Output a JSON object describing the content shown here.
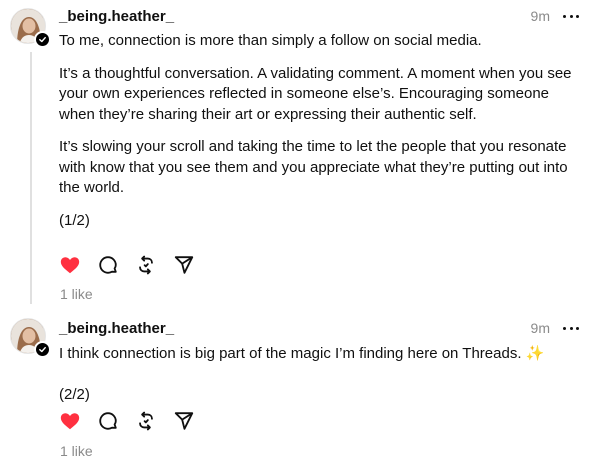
{
  "posts": [
    {
      "username": "_being.heather_",
      "time": "9m",
      "paragraphs": [
        "To me, connection is more than simply a follow on social media.",
        "It’s a thoughtful conversation. A validating comment. A moment when you see your own experiences reflected in someone else’s. Encouraging someone when they’re sharing their art or expressing their authentic self.",
        "It’s slowing your scroll and taking the time to let the people that you resonate with know that you see them and you appreciate what they’re putting out into the world.",
        "(1/2)"
      ],
      "likes": "1 like",
      "liked": true
    },
    {
      "username": "_being.heather_",
      "time": "9m",
      "paragraphs": [
        "I think connection is big part of the magic I’m finding here on Threads.",
        "(2/2)"
      ],
      "emoji": "✨",
      "likes": "1 like",
      "liked": true
    }
  ],
  "colors": {
    "like": "#ff3040",
    "muted": "#8a8a8a",
    "text": "#101010",
    "thread_line": "#e0e0e0"
  },
  "icons": [
    "heart-icon",
    "comment-icon",
    "repost-icon",
    "share-icon",
    "more-icon",
    "verified-badge-icon"
  ]
}
